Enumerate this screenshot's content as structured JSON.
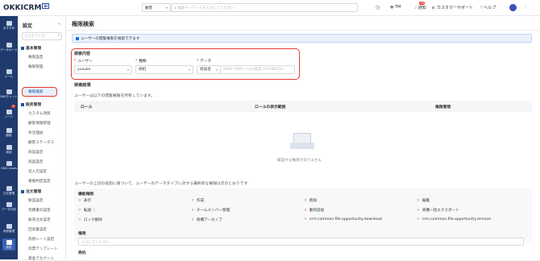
{
  "app": {
    "logo": "OKKICRM",
    "logo_badge": "AI"
  },
  "topbar": {
    "search_scope": "顧客",
    "search_placeholder": "検索キーワードを入力してください",
    "user": "TM",
    "notify_label": "通知",
    "notify_count": "99",
    "support_label": "カスタマーサポート",
    "help_label": "ヘルプ"
  },
  "nav": {
    "items": [
      "おすすめ",
      "データボード",
      "メール",
      "SNSチャット",
      "リード",
      "顧客",
      "商談",
      "OKKI Leads",
      "注文管理",
      "データ分析",
      "承認管理",
      "設定"
    ],
    "lead_badge": "9"
  },
  "sidebar": {
    "title": "設定",
    "search_placeholder": "カスタマイズ",
    "sections": [
      {
        "title": "基本管理",
        "items": [
          "権限設定",
          "権限管理",
          "権限検索"
        ]
      },
      {
        "title": "販売管理",
        "items": [
          "カスタム項目",
          "顧客情報管理",
          "失注理由",
          "顧客ステータス",
          "商談設定",
          "商品設定",
          "流入元設定",
          "重複判定設定"
        ]
      },
      {
        "title": "注文管理",
        "items": [
          "製品設定",
          "見積書の設定",
          "販売注文設定",
          "回収書設定",
          "為替レート設定",
          "伝票テンプレート",
          "資金アカウント"
        ]
      }
    ],
    "active_item": "権限検索"
  },
  "main": {
    "page_title": "権限検索",
    "info_banner": "ユーザーの閲覧権限を検索できます",
    "search_section_title": "検索内容",
    "fields": {
      "user_label": "ユーザー",
      "user_value": "yusuke",
      "type_label": "種類",
      "type_value": "商机",
      "data_label": "データ",
      "data_select": "商談名",
      "data_placeholder": "OKKI CRM×-com提案 (X3786550..."
    },
    "results_title": "検索結果",
    "results_desc": "ユーザーは以下の閲覧権限を所有しています。",
    "table_headers": [
      "ロール",
      "ロールの表示範囲",
      "権限管理"
    ],
    "empty_text": "確認する権限がありません",
    "bottom_desc": "ユーザーの上記の役割に基づいて、ユーザーのデータタイプに対する最終的な権限は次のとおりです",
    "func_perm_title": "機能権限",
    "permissions": [
      "表示",
      "作成",
      "削除",
      "編集",
      "転送",
      "チームメンバー管理",
      "動的追加",
      "商機一括エクスポート",
      "ロック解除",
      "商機アーカイブ",
      "crm.common.file.opportunity.download",
      "crm.common.file.opportunity.remove"
    ],
    "authority_title": "権限",
    "authority_placeholder": "入力してください",
    "bottom_label": "商机"
  },
  "colors": {
    "nav_bg": "#1f3b6e",
    "accent": "#1f4fa3",
    "highlight": "#e53935",
    "deny": "#e57373"
  }
}
